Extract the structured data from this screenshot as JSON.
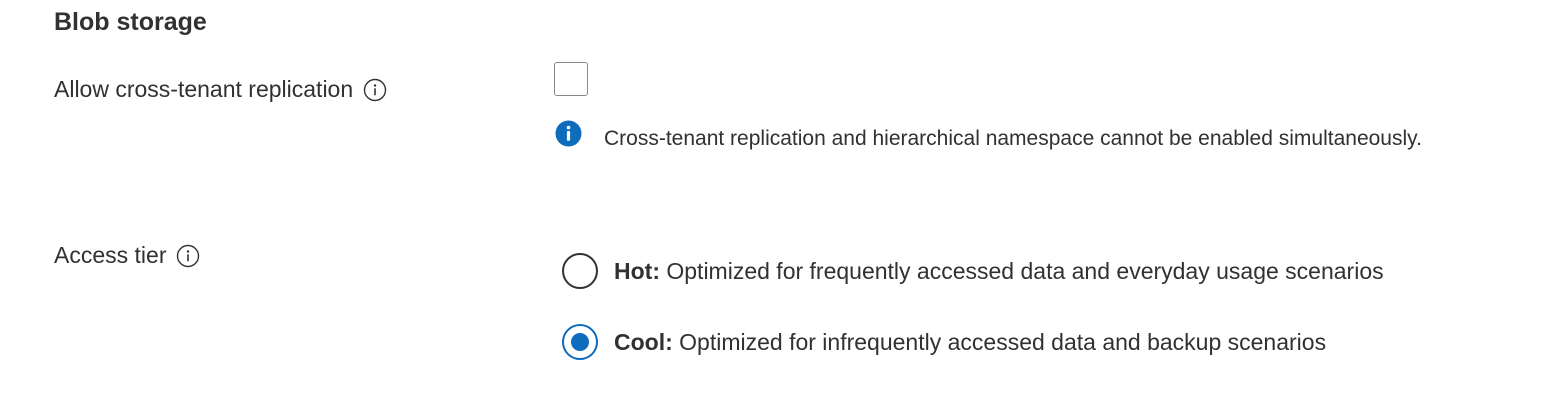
{
  "section": {
    "title": "Blob storage"
  },
  "cross_tenant": {
    "label": "Allow cross-tenant replication",
    "checked": false,
    "notice": "Cross-tenant replication and hierarchical namespace cannot be enabled simultaneously."
  },
  "access_tier": {
    "label": "Access tier",
    "options": [
      {
        "name": "Hot:",
        "description": " Optimized for frequently accessed data and everyday usage scenarios",
        "selected": false
      },
      {
        "name": "Cool:",
        "description": " Optimized for infrequently accessed data and backup scenarios",
        "selected": true
      }
    ]
  },
  "icons": {
    "label_info": "info-circle-outline-icon",
    "notice": "info-filled-icon"
  },
  "colors": {
    "accent": "#0f6cbd",
    "text": "#323130",
    "border": "#8a8886"
  }
}
